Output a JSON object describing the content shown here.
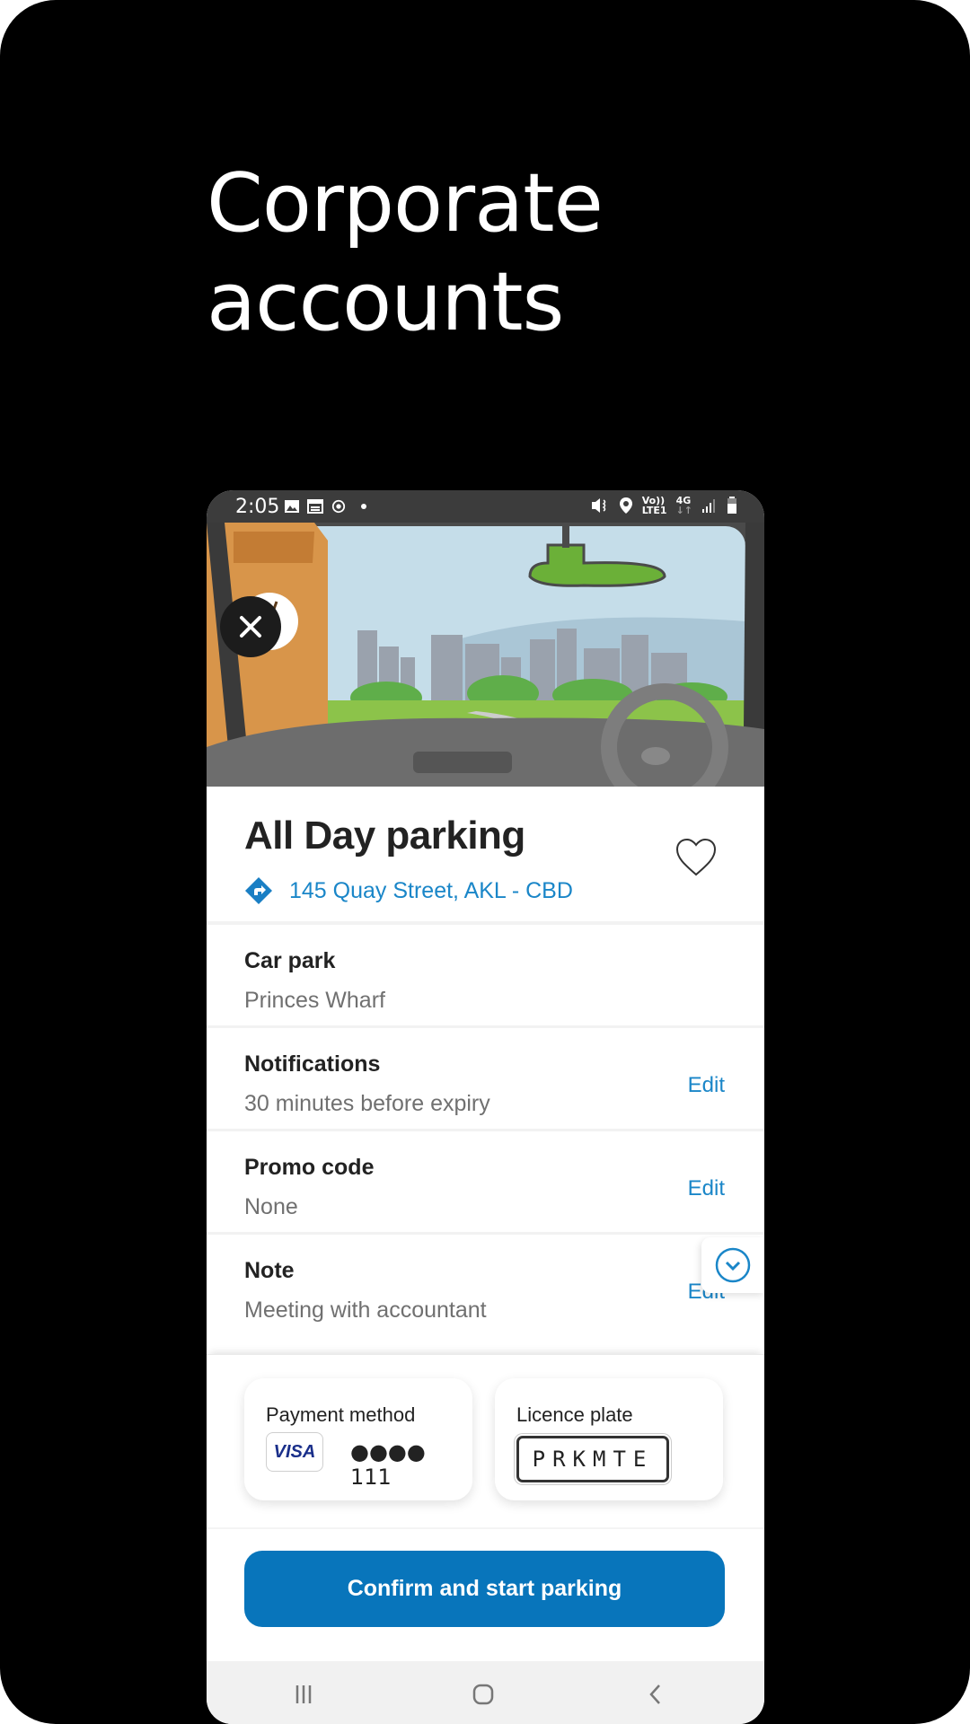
{
  "headline": {
    "line1": "Corporate",
    "line2": "accounts"
  },
  "status_bar": {
    "time": "2:05",
    "left_icons": [
      "gallery-icon",
      "calendar-icon",
      "sync-icon",
      "dot-icon"
    ],
    "right_icons": [
      "mute-vibrate-icon",
      "location-icon",
      "volte-icon",
      "4g-icon",
      "signal-icon",
      "battery-icon"
    ],
    "network_top": "Vo)) ",
    "network_bottom": "LTE1",
    "network_type": "4G"
  },
  "header": {
    "title": "All Day parking",
    "address": "145 Quay Street, AKL - CBD",
    "favorite": false
  },
  "details": [
    {
      "label": "Car park",
      "value": "Princes Wharf",
      "action": ""
    },
    {
      "label": "Notifications",
      "value": "30 minutes before expiry",
      "action": "Edit"
    },
    {
      "label": "Promo code",
      "value": "None",
      "action": "Edit"
    },
    {
      "label": "Note",
      "value": "Meeting with accountant",
      "action": "Edit"
    }
  ],
  "payment": {
    "label": "Payment method",
    "card_brand": "VISA",
    "masked_number": "●●●● 111"
  },
  "licence": {
    "label": "Licence plate",
    "plate": "PRKMTE"
  },
  "confirm_button": "Confirm and start parking",
  "colors": {
    "accent": "#1a86c8",
    "button": "#0875bb",
    "title": "#222222",
    "value": "#707070"
  }
}
